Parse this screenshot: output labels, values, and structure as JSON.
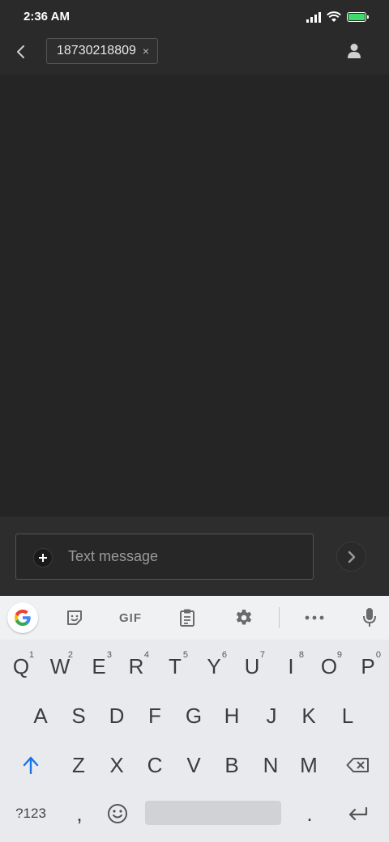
{
  "status_bar": {
    "time": "2:36 AM",
    "battery_level": 1.0,
    "battery_color": "#3ddc6a"
  },
  "header": {
    "back_icon": "chevron-left-icon",
    "recipient": "18730218809",
    "chip_remove": "×",
    "contact_icon": "person-icon"
  },
  "composer": {
    "placeholder": "Text message",
    "attach_icon": "plus-circle-icon",
    "send_icon": "chevron-right-icon"
  },
  "keyboard": {
    "toolbar": {
      "google": "google-logo-icon",
      "sticker": "sticker-icon",
      "gif": "GIF",
      "clipboard": "clipboard-icon",
      "settings": "gear-icon",
      "more": "more-icon",
      "mic": "microphone-icon"
    },
    "row1": [
      {
        "key": "Q",
        "hint": "1"
      },
      {
        "key": "W",
        "hint": "2"
      },
      {
        "key": "E",
        "hint": "3"
      },
      {
        "key": "R",
        "hint": "4"
      },
      {
        "key": "T",
        "hint": "5"
      },
      {
        "key": "Y",
        "hint": "6"
      },
      {
        "key": "U",
        "hint": "7"
      },
      {
        "key": "I",
        "hint": "8"
      },
      {
        "key": "O",
        "hint": "9"
      },
      {
        "key": "P",
        "hint": "0"
      }
    ],
    "row2": [
      "A",
      "S",
      "D",
      "F",
      "G",
      "H",
      "J",
      "K",
      "L"
    ],
    "row3": [
      "Z",
      "X",
      "C",
      "V",
      "B",
      "N",
      "M"
    ],
    "row4": {
      "symbols": "?123",
      "comma": ",",
      "period": ".",
      "emoji_icon": "emoji-icon",
      "enter_icon": "enter-icon",
      "shift_icon": "shift-icon",
      "backspace_icon": "backspace-icon"
    },
    "accent_color": "#1a73e8"
  }
}
